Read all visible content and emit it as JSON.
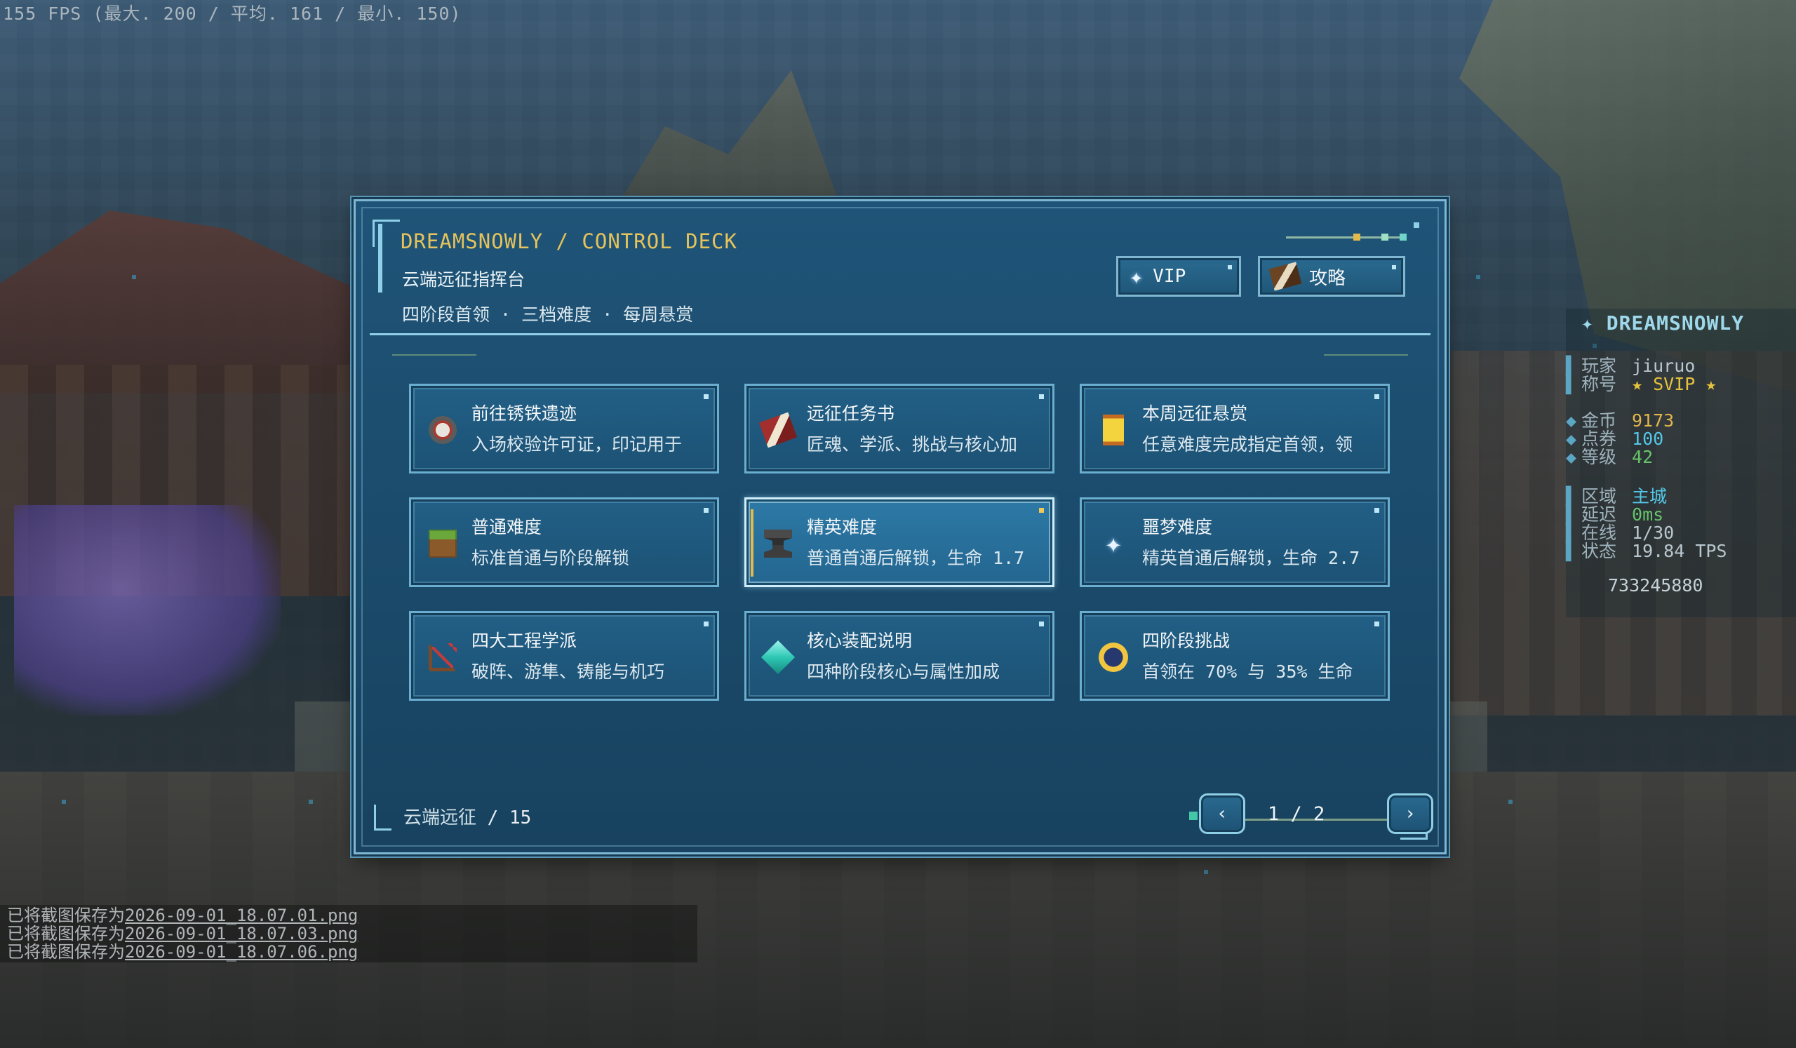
{
  "hud": {
    "fps": "155 FPS (最大. 200 / 平均. 161 / 最小. 150)",
    "chat": [
      {
        "prefix": "已将截图保存为",
        "file": "2026-09-01_18.07.01.png"
      },
      {
        "prefix": "已将截图保存为",
        "file": "2026-09-01_18.07.03.png"
      },
      {
        "prefix": "已将截图保存为",
        "file": "2026-09-01_18.07.06.png"
      }
    ]
  },
  "scoreboard": {
    "title": "✦ DREAMSNOWLY",
    "rows": [
      {
        "key": "玩家",
        "value": "jiuruo",
        "color": "#b9c7cf"
      },
      {
        "key": "称号",
        "value": "★ SVIP ★",
        "color": "#e5c23d"
      },
      {
        "key": "金币",
        "value": "9173",
        "color": "#e2b64a"
      },
      {
        "key": "点券",
        "value": "100",
        "color": "#54c7e8"
      },
      {
        "key": "等级",
        "value": "42",
        "color": "#67c46a"
      },
      {
        "key": "区域",
        "value": "主城",
        "color": "#54c7e8"
      },
      {
        "key": "延迟",
        "value": "0ms",
        "color": "#67c46a"
      },
      {
        "key": "在线",
        "value": "1/30",
        "color": "#b9c7cf"
      },
      {
        "key": "状态",
        "value": "19.84 TPS",
        "color": "#b9c7cf"
      }
    ],
    "id": "733245880"
  },
  "panel": {
    "brand": "DREAMSNOWLY / CONTROL DECK",
    "subtitle": "云端远征指挥台",
    "tagline": "四阶段首领 · 三档难度 · 每周悬赏",
    "buttons": {
      "vip": "VIP",
      "guide": "攻略"
    },
    "tiles": [
      {
        "title": "前往锈铁遗迹",
        "desc": "入场校验许可证，印记用于",
        "icon": "compass-icon"
      },
      {
        "title": "远征任务书",
        "desc": "匠魂、学派、挑战与核心加",
        "icon": "book-icon"
      },
      {
        "title": "本周远征悬赏",
        "desc": "任意难度完成指定首领，领",
        "icon": "scroll-icon"
      },
      {
        "title": "普通难度",
        "desc": "标准首通与阶段解锁",
        "icon": "grass-block-icon"
      },
      {
        "title": "精英难度",
        "desc": "普通首通后解锁，生命 1.7",
        "icon": "anvil-icon",
        "selected": true
      },
      {
        "title": "噩梦难度",
        "desc": "精英首通后解锁，生命 2.7",
        "icon": "nether-star-icon"
      },
      {
        "title": "四大工程学派",
        "desc": "破阵、游隼、铸能与机巧",
        "icon": "bow-icon"
      },
      {
        "title": "核心装配说明",
        "desc": "四种阶段核心与属性加成",
        "icon": "diamond-icon"
      },
      {
        "title": "四阶段挑战",
        "desc": "首领在 70% 与 35% 生命",
        "icon": "clock-icon"
      }
    ],
    "footer": {
      "label": "云端远征",
      "count": "/ 15",
      "page": "1 / 2"
    }
  }
}
